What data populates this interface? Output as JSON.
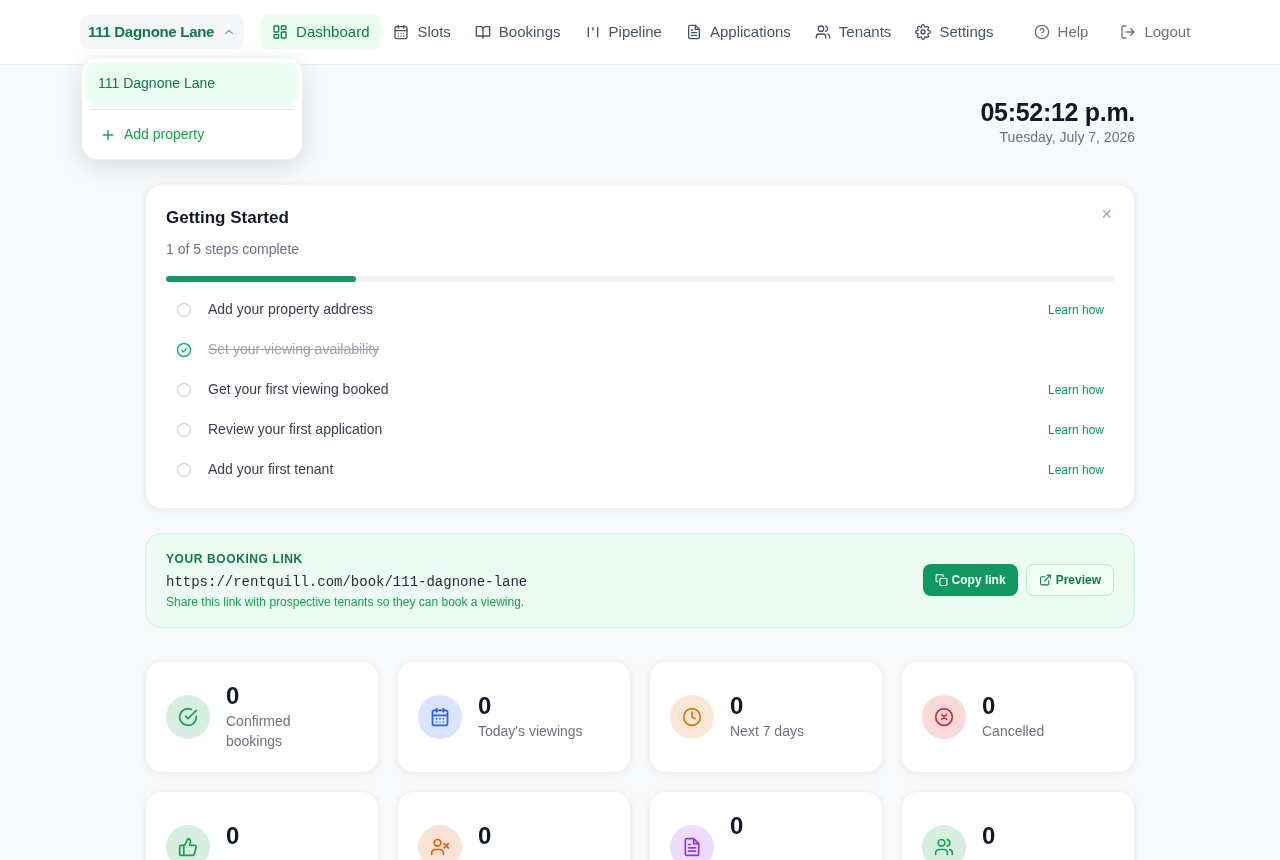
{
  "property_selector": {
    "label": "111 Dagnone Lane",
    "expanded": true
  },
  "nav": [
    {
      "label": "Dashboard",
      "selected": true
    },
    {
      "label": "Slots",
      "selected": false
    },
    {
      "label": "Bookings",
      "selected": false
    },
    {
      "label": "Pipeline",
      "selected": false
    },
    {
      "label": "Applications",
      "selected": false
    },
    {
      "label": "Tenants",
      "selected": false
    },
    {
      "label": "Settings",
      "selected": false
    }
  ],
  "utility_nav": [
    {
      "label": "Help"
    },
    {
      "label": "Logout"
    }
  ],
  "property_menu": {
    "items": [
      {
        "label": "111 Dagnone Lane",
        "selected": true
      }
    ],
    "add_label": "Add property"
  },
  "clock": {
    "time": "05:52:12 p.m.",
    "date": "Tuesday, July 7, 2026"
  },
  "getting_started": {
    "title": "Getting Started",
    "subtitle": "1 of 5 steps complete",
    "close": "×",
    "level": 0.2,
    "steps": [
      {
        "label": "Add your property address",
        "checked": false,
        "link": "Learn how"
      },
      {
        "label": "Set your viewing availability",
        "checked": true
      },
      {
        "label": "Get your first viewing booked",
        "checked": false,
        "link": "Learn how"
      },
      {
        "label": "Review your first application",
        "checked": false,
        "link": "Learn how"
      },
      {
        "label": "Add your first tenant",
        "checked": false,
        "link": "Learn how"
      }
    ]
  },
  "booking_link": {
    "heading": "YOUR BOOKING LINK",
    "url": "https://rentquill.com/book/111-dagnone-lane",
    "hint": "Share this link with prospective tenants so they can book a viewing.",
    "copy_button": "Copy link",
    "preview_button": "Preview"
  },
  "stats": [
    {
      "value": "0",
      "label": "Confirmed bookings",
      "color": "#16a34a"
    },
    {
      "value": "0",
      "label": "Today's viewings",
      "color": "#2563eb"
    },
    {
      "value": "0",
      "label": "Next 7 days",
      "color": "#d97706"
    },
    {
      "value": "0",
      "label": "Cancelled",
      "color": "#dc2626"
    },
    {
      "value": "0",
      "color": "#16a34a"
    },
    {
      "value": "0",
      "color": "#ea580c"
    },
    {
      "value": "0",
      "color": "#9333ea"
    },
    {
      "value": "0",
      "color": "#16a34a"
    }
  ]
}
